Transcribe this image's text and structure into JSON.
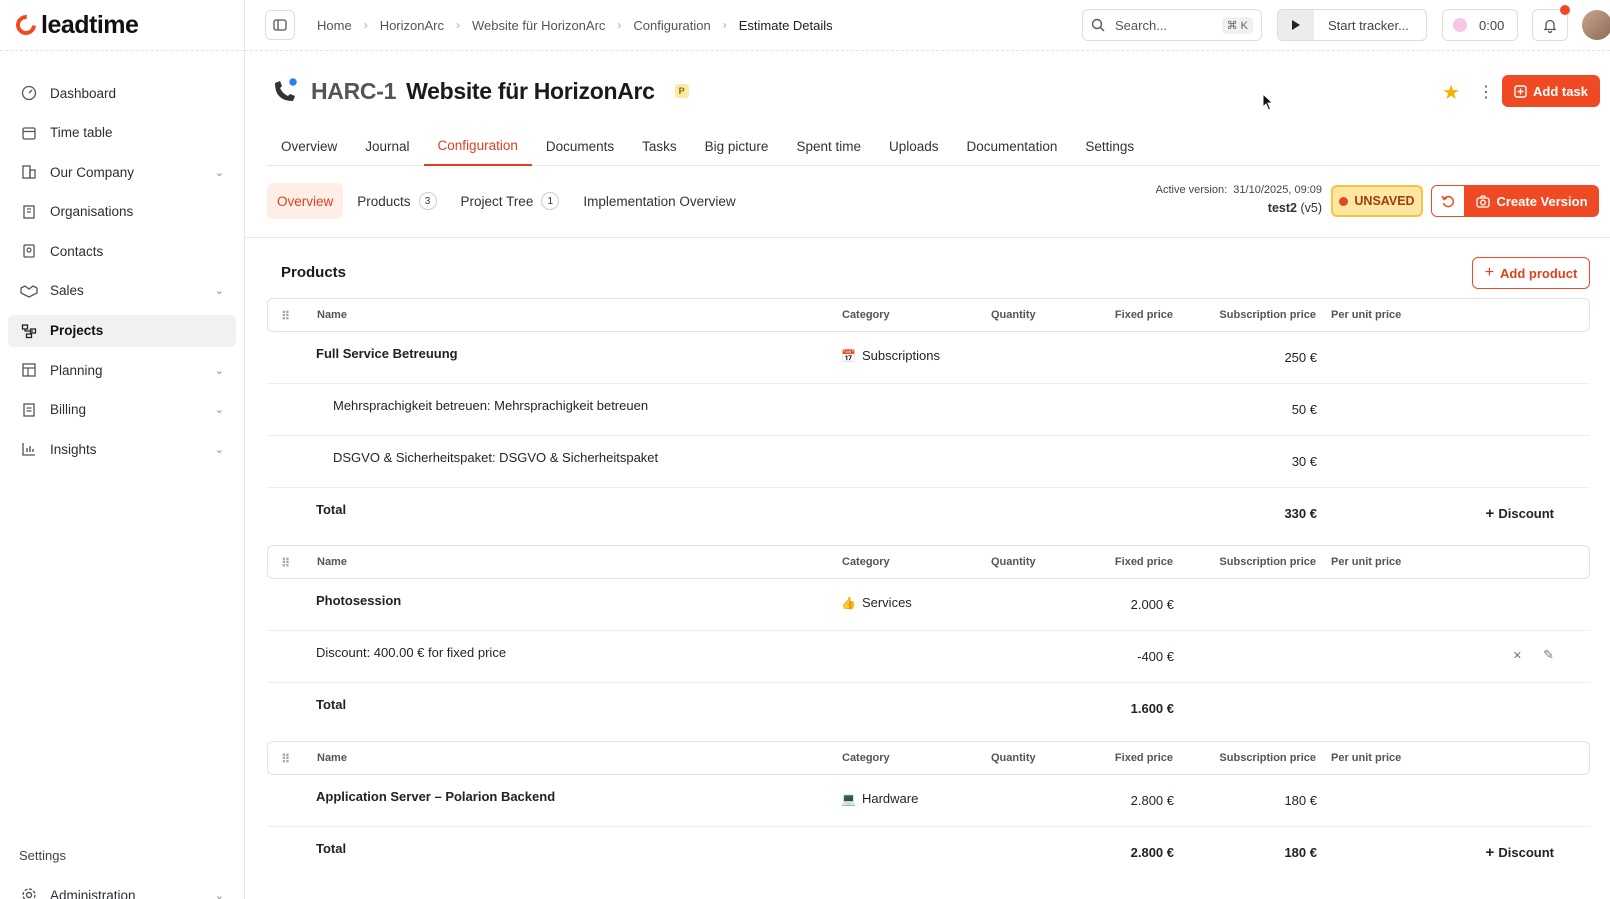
{
  "brand": {
    "name": "leadtime"
  },
  "sidebar": {
    "items": [
      {
        "label": "Dashboard",
        "icon": "dashboard-icon",
        "chevron": false
      },
      {
        "label": "Time table",
        "icon": "calendar-icon",
        "chevron": false
      },
      {
        "label": "Our Company",
        "icon": "building-icon",
        "chevron": true
      },
      {
        "label": "Organisations",
        "icon": "organisations-icon",
        "chevron": false
      },
      {
        "label": "Contacts",
        "icon": "contacts-icon",
        "chevron": false
      },
      {
        "label": "Sales",
        "icon": "handshake-icon",
        "chevron": true
      },
      {
        "label": "Projects",
        "icon": "projects-icon",
        "chevron": false,
        "active": true
      },
      {
        "label": "Planning",
        "icon": "planning-icon",
        "chevron": true
      },
      {
        "label": "Billing",
        "icon": "billing-icon",
        "chevron": true
      },
      {
        "label": "Insights",
        "icon": "insights-icon",
        "chevron": true
      }
    ],
    "settings_label": "Settings",
    "administration_label": "Administration"
  },
  "topbar": {
    "breadcrumbs": [
      "Home",
      "HorizonArc",
      "Website für HorizonArc",
      "Configuration",
      "Estimate Details"
    ],
    "search_label": "Search...",
    "search_shortcut": "⌘ K",
    "tracker_label": "Start tracker...",
    "timer": "0:00"
  },
  "page": {
    "project_id": "HARC-1",
    "project_name": "Website für HorizonArc",
    "badge": "P",
    "add_task_label": "Add task"
  },
  "tabs": [
    "Overview",
    "Journal",
    "Configuration",
    "Documents",
    "Tasks",
    "Big picture",
    "Spent time",
    "Uploads",
    "Documentation",
    "Settings"
  ],
  "active_tab": "Configuration",
  "subtabs": [
    {
      "label": "Overview",
      "count": null,
      "active": true
    },
    {
      "label": "Products",
      "count": "3"
    },
    {
      "label": "Project Tree",
      "count": "1"
    },
    {
      "label": "Implementation Overview",
      "count": null
    }
  ],
  "version": {
    "active_label": "Active version:",
    "active_date": "31/10/2025, 09:09",
    "name": "test2",
    "ver": "(v5)",
    "status": "UNSAVED",
    "create_label": "Create Version"
  },
  "products": {
    "title": "Products",
    "add_label": "Add product",
    "columns": [
      "Name",
      "Category",
      "Quantity",
      "Fixed price",
      "Subscription price",
      "Per unit price"
    ],
    "groups": [
      {
        "rows": [
          {
            "name": "Full Service Betreuung",
            "bold": true,
            "category": "Subscriptions",
            "cat_icon": "📅",
            "fixed": "",
            "sub": "250 €"
          },
          {
            "name": "Mehrsprachigkeit betreuen:  Mehrsprachigkeit betreuen",
            "indent": true,
            "category": "",
            "fixed": "",
            "sub": "50 €"
          },
          {
            "name": "DSGVO & Sicherheitspaket:  DSGVO & Sicherheitspaket",
            "indent": true,
            "category": "",
            "fixed": "",
            "sub": "30 €"
          }
        ],
        "total_label": "Total",
        "total_fixed": "",
        "total_sub": "330 €",
        "discount_label": "Discount"
      },
      {
        "rows": [
          {
            "name": "Photosession",
            "bold": true,
            "category": "Services",
            "cat_icon": "👍",
            "fixed": "2.000 €",
            "sub": ""
          },
          {
            "name": "Discount: 400.00 € for fixed price",
            "category": "",
            "fixed": "-400 €",
            "sub": "",
            "is_discount": true
          }
        ],
        "total_label": "Total",
        "total_fixed": "1.600 €",
        "total_sub": "",
        "discount_label": ""
      },
      {
        "rows": [
          {
            "name": "Application Server – Polarion Backend",
            "bold": true,
            "category": "Hardware",
            "cat_icon": "💻",
            "fixed": "2.800 €",
            "sub": "180 €"
          }
        ],
        "total_label": "Total",
        "total_fixed": "2.800 €",
        "total_sub": "180 €",
        "discount_label": "Discount"
      }
    ]
  }
}
